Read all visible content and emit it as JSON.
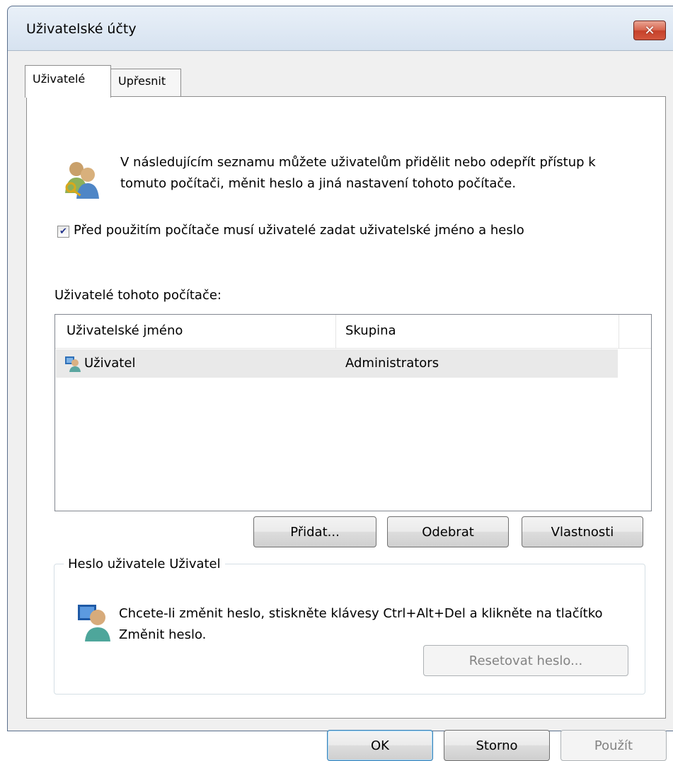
{
  "window": {
    "title": "Uživatelské účty",
    "close_label": "✕"
  },
  "tabs": [
    {
      "label": "Uživatelé",
      "active": true
    },
    {
      "label": "Upřesnit",
      "active": false
    }
  ],
  "users_tab": {
    "description": "V následujícím seznamu můžete uživatelům přidělit nebo odepřít přístup k tomuto počítači, měnit heslo a jiná nastavení tohoto počítače.",
    "require_login_checkbox": {
      "checked": true,
      "check_mark": "✔",
      "label": "Před použitím počítače musí uživatelé zadat uživatelské jméno a heslo"
    },
    "list_label": "Uživatelé tohoto počítače:",
    "list": {
      "columns": [
        "Uživatelské jméno",
        "Skupina"
      ],
      "rows": [
        {
          "name": "Uživatel",
          "group": "Administrators",
          "icon": "user-account-icon",
          "selected": true
        }
      ]
    },
    "buttons": {
      "add": "Přidat...",
      "remove": "Odebrat",
      "properties": "Vlastnosti"
    },
    "password_group": {
      "legend": "Heslo uživatele Uživatel",
      "text": "Chcete-li změnit heslo, stiskněte klávesy Ctrl+Alt+Del a klikněte na tlačítko Změnit heslo.",
      "reset_button": "Resetovat heslo...",
      "icon": "user-monitor-icon"
    }
  },
  "footer": {
    "ok": "OK",
    "cancel": "Storno",
    "apply": "Použít"
  },
  "icons": {
    "users_header": "users-key-icon"
  }
}
